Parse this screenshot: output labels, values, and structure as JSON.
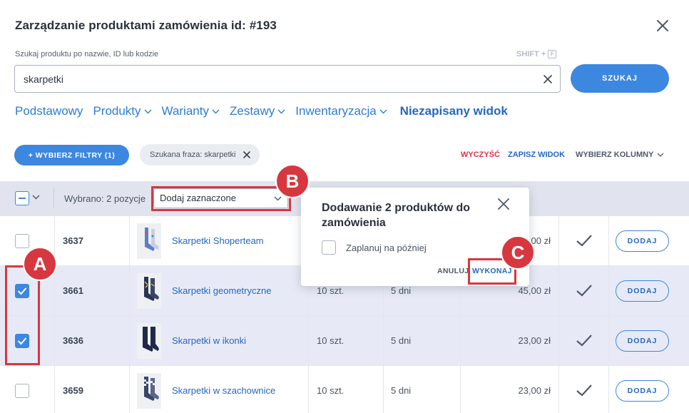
{
  "header": {
    "title": "Zarządzanie produktami zamówienia id: #193"
  },
  "search": {
    "label": "Szukaj produktu po nazwie, ID lub kodzie",
    "shortcut_text": "SHIFT +",
    "shortcut_key": "F",
    "value": "skarpetki",
    "button_label": "SZUKAJ"
  },
  "views": [
    {
      "label": "Podstawowy"
    },
    {
      "label": "Produkty"
    },
    {
      "label": "Warianty"
    },
    {
      "label": "Zestawy"
    },
    {
      "label": "Inwentaryzacja"
    },
    {
      "label": "Niezapisany widok"
    }
  ],
  "toolbar": {
    "filters_button": "+ WYBIERZ FILTRY (1)",
    "chip_label": "Szukana fraza: skarpetki",
    "clear_label": "WYCZYŚĆ",
    "save_view_label": "ZAPISZ WIDOK",
    "columns_label": "WYBIERZ KOLUMNY"
  },
  "bulk": {
    "selected_text": "Wybrano: 2 pozycje",
    "action_select_value": "Dodaj zaznaczone"
  },
  "rows": [
    {
      "id": "3637",
      "name": "Skarpetki Shoperteam",
      "qty": "",
      "days": "",
      "price": ",00 zł",
      "checked": false,
      "add_label": "DODAJ"
    },
    {
      "id": "3661",
      "name": "Skarpetki geometryczne",
      "qty": "10 szt.",
      "days": "5 dni",
      "price": "45,00 zł",
      "checked": true,
      "add_label": "DODAJ"
    },
    {
      "id": "3636",
      "name": "Skarpetki w ikonki",
      "qty": "10 szt.",
      "days": "5 dni",
      "price": "23,00 zł",
      "checked": true,
      "add_label": "DODAJ"
    },
    {
      "id": "3659",
      "name": "Skarpetki w szachownice",
      "qty": "10 szt.",
      "days": "5 dni",
      "price": "23,00 zł",
      "checked": false,
      "add_label": "DODAJ"
    }
  ],
  "popover": {
    "title": "Dodawanie 2 produktów do zamówienia",
    "schedule_label": "Zaplanuj na później",
    "cancel_label": "ANULUJ",
    "run_label": "WYKONAJ"
  },
  "annotations": {
    "a": "A",
    "b": "B",
    "c": "C"
  },
  "colors": {
    "accent": "#3c87e0",
    "link": "#2467c2",
    "danger": "#d8344c",
    "annotation": "#d7373f",
    "selected_row": "#e7eaf6",
    "bulk_bar": "#e1e4ee"
  }
}
